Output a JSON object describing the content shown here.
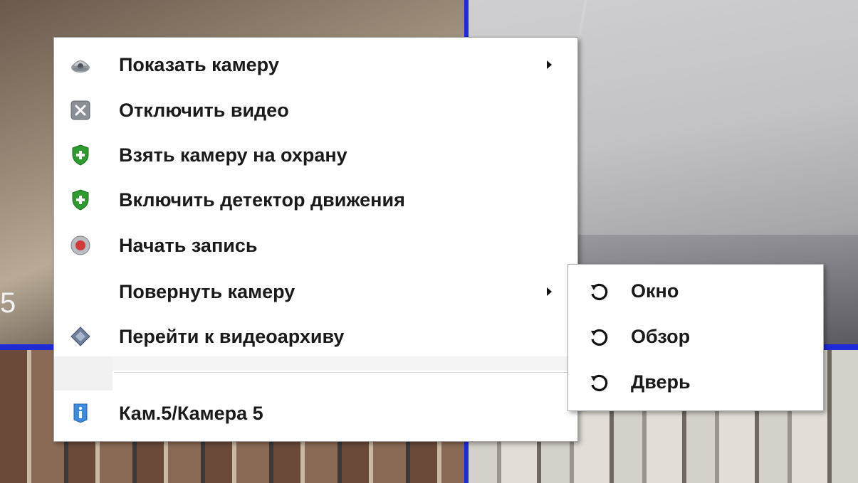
{
  "background": {
    "camera_number_label": "5",
    "grid_divider_color": "#1f2bd6"
  },
  "context_menu": {
    "items": [
      {
        "label": "Показать камеру",
        "icon": "camera-dome-icon",
        "has_submenu": true
      },
      {
        "label": "Отключить видео",
        "icon": "disable-video-icon",
        "has_submenu": false
      },
      {
        "label": "Взять камеру на охрану",
        "icon": "shield-plus-icon",
        "has_submenu": false
      },
      {
        "label": "Включить детектор движения",
        "icon": "shield-plus-icon",
        "has_submenu": false
      },
      {
        "label": "Начать запись",
        "icon": "record-icon",
        "has_submenu": false
      },
      {
        "label": "Повернуть камеру",
        "icon": "",
        "has_submenu": true
      },
      {
        "label": "Перейти к видеоархиву",
        "icon": "archive-diamond-icon",
        "has_submenu": false
      }
    ],
    "footer": {
      "label": "Кам.5/Камера 5",
      "icon": "info-icon"
    }
  },
  "rotate_submenu": {
    "items": [
      {
        "label": "Окно",
        "icon": "rotate-icon"
      },
      {
        "label": "Обзор",
        "icon": "rotate-icon"
      },
      {
        "label": "Дверь",
        "icon": "rotate-icon"
      }
    ]
  },
  "colors": {
    "shield_green": "#2e9b2e",
    "record_red": "#d23a3a",
    "info_blue": "#3d8be0"
  }
}
